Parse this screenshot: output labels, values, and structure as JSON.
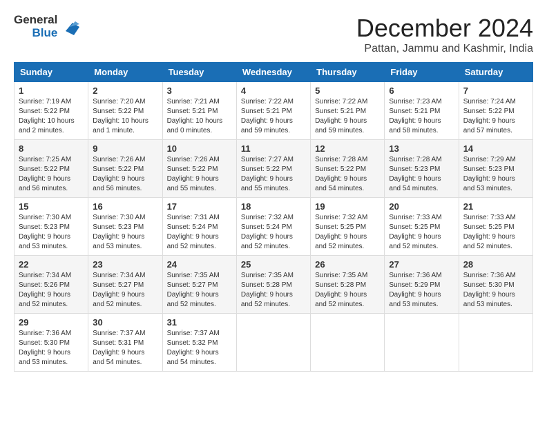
{
  "header": {
    "logo_line1": "General",
    "logo_line2": "Blue",
    "month_title": "December 2024",
    "location": "Pattan, Jammu and Kashmir, India"
  },
  "weekdays": [
    "Sunday",
    "Monday",
    "Tuesday",
    "Wednesday",
    "Thursday",
    "Friday",
    "Saturday"
  ],
  "weeks": [
    [
      {
        "day": "1",
        "sunrise": "7:19 AM",
        "sunset": "5:22 PM",
        "daylight": "10 hours and 2 minutes."
      },
      {
        "day": "2",
        "sunrise": "7:20 AM",
        "sunset": "5:22 PM",
        "daylight": "10 hours and 1 minute."
      },
      {
        "day": "3",
        "sunrise": "7:21 AM",
        "sunset": "5:21 PM",
        "daylight": "10 hours and 0 minutes."
      },
      {
        "day": "4",
        "sunrise": "7:22 AM",
        "sunset": "5:21 PM",
        "daylight": "9 hours and 59 minutes."
      },
      {
        "day": "5",
        "sunrise": "7:22 AM",
        "sunset": "5:21 PM",
        "daylight": "9 hours and 59 minutes."
      },
      {
        "day": "6",
        "sunrise": "7:23 AM",
        "sunset": "5:21 PM",
        "daylight": "9 hours and 58 minutes."
      },
      {
        "day": "7",
        "sunrise": "7:24 AM",
        "sunset": "5:22 PM",
        "daylight": "9 hours and 57 minutes."
      }
    ],
    [
      {
        "day": "8",
        "sunrise": "7:25 AM",
        "sunset": "5:22 PM",
        "daylight": "9 hours and 56 minutes."
      },
      {
        "day": "9",
        "sunrise": "7:26 AM",
        "sunset": "5:22 PM",
        "daylight": "9 hours and 56 minutes."
      },
      {
        "day": "10",
        "sunrise": "7:26 AM",
        "sunset": "5:22 PM",
        "daylight": "9 hours and 55 minutes."
      },
      {
        "day": "11",
        "sunrise": "7:27 AM",
        "sunset": "5:22 PM",
        "daylight": "9 hours and 55 minutes."
      },
      {
        "day": "12",
        "sunrise": "7:28 AM",
        "sunset": "5:22 PM",
        "daylight": "9 hours and 54 minutes."
      },
      {
        "day": "13",
        "sunrise": "7:28 AM",
        "sunset": "5:23 PM",
        "daylight": "9 hours and 54 minutes."
      },
      {
        "day": "14",
        "sunrise": "7:29 AM",
        "sunset": "5:23 PM",
        "daylight": "9 hours and 53 minutes."
      }
    ],
    [
      {
        "day": "15",
        "sunrise": "7:30 AM",
        "sunset": "5:23 PM",
        "daylight": "9 hours and 53 minutes."
      },
      {
        "day": "16",
        "sunrise": "7:30 AM",
        "sunset": "5:23 PM",
        "daylight": "9 hours and 53 minutes."
      },
      {
        "day": "17",
        "sunrise": "7:31 AM",
        "sunset": "5:24 PM",
        "daylight": "9 hours and 52 minutes."
      },
      {
        "day": "18",
        "sunrise": "7:32 AM",
        "sunset": "5:24 PM",
        "daylight": "9 hours and 52 minutes."
      },
      {
        "day": "19",
        "sunrise": "7:32 AM",
        "sunset": "5:25 PM",
        "daylight": "9 hours and 52 minutes."
      },
      {
        "day": "20",
        "sunrise": "7:33 AM",
        "sunset": "5:25 PM",
        "daylight": "9 hours and 52 minutes."
      },
      {
        "day": "21",
        "sunrise": "7:33 AM",
        "sunset": "5:25 PM",
        "daylight": "9 hours and 52 minutes."
      }
    ],
    [
      {
        "day": "22",
        "sunrise": "7:34 AM",
        "sunset": "5:26 PM",
        "daylight": "9 hours and 52 minutes."
      },
      {
        "day": "23",
        "sunrise": "7:34 AM",
        "sunset": "5:27 PM",
        "daylight": "9 hours and 52 minutes."
      },
      {
        "day": "24",
        "sunrise": "7:35 AM",
        "sunset": "5:27 PM",
        "daylight": "9 hours and 52 minutes."
      },
      {
        "day": "25",
        "sunrise": "7:35 AM",
        "sunset": "5:28 PM",
        "daylight": "9 hours and 52 minutes."
      },
      {
        "day": "26",
        "sunrise": "7:35 AM",
        "sunset": "5:28 PM",
        "daylight": "9 hours and 52 minutes."
      },
      {
        "day": "27",
        "sunrise": "7:36 AM",
        "sunset": "5:29 PM",
        "daylight": "9 hours and 53 minutes."
      },
      {
        "day": "28",
        "sunrise": "7:36 AM",
        "sunset": "5:30 PM",
        "daylight": "9 hours and 53 minutes."
      }
    ],
    [
      {
        "day": "29",
        "sunrise": "7:36 AM",
        "sunset": "5:30 PM",
        "daylight": "9 hours and 53 minutes."
      },
      {
        "day": "30",
        "sunrise": "7:37 AM",
        "sunset": "5:31 PM",
        "daylight": "9 hours and 54 minutes."
      },
      {
        "day": "31",
        "sunrise": "7:37 AM",
        "sunset": "5:32 PM",
        "daylight": "9 hours and 54 minutes."
      },
      null,
      null,
      null,
      null
    ]
  ]
}
